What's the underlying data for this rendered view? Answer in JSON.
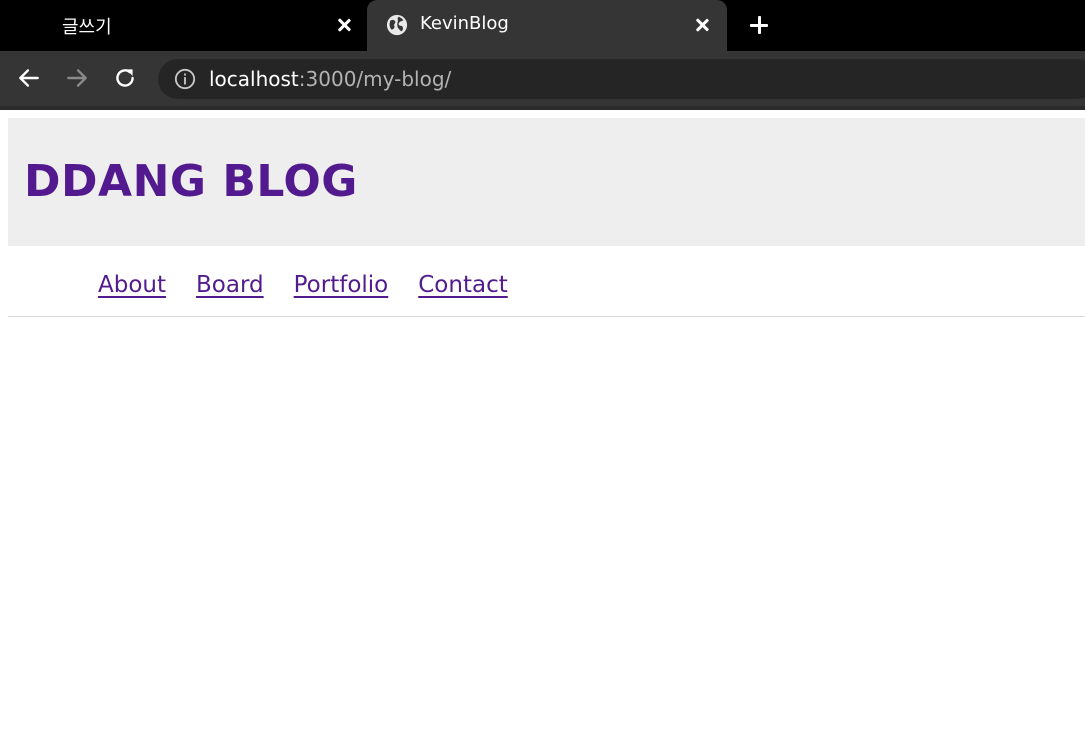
{
  "tabs": [
    {
      "title": "글쓰기",
      "active": false
    },
    {
      "title": "KevinBlog",
      "active": true,
      "icon": "globe-icon"
    }
  ],
  "toolbar": {
    "back_icon": "arrow-left-icon",
    "forward_icon": "arrow-right-icon",
    "reload_icon": "reload-icon",
    "url_host": "localhost",
    "url_rest": ":3000/my-blog/"
  },
  "site": {
    "title": "DDANG BLOG",
    "nav": [
      {
        "label": "About"
      },
      {
        "label": "Board"
      },
      {
        "label": "Portfolio"
      },
      {
        "label": "Contact"
      }
    ]
  },
  "colors": {
    "title": "#531a8f",
    "link": "#521c8e",
    "header_bg": "#eeeeee",
    "tabstrip_bg": "#000000",
    "toolbar_bg": "#353535"
  }
}
